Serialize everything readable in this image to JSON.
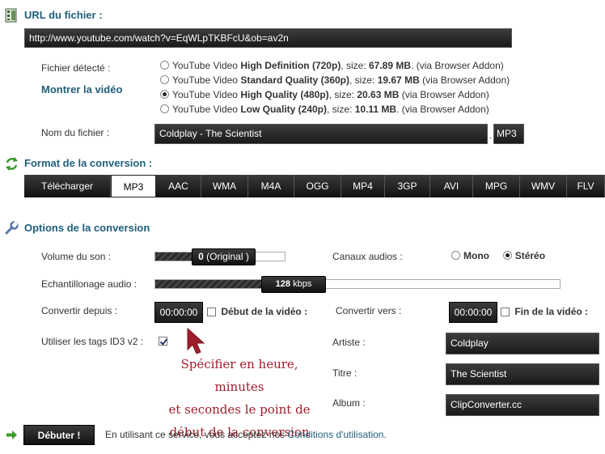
{
  "url_section": {
    "title": "URL du fichier :",
    "url_value": "http://www.youtube.com/watch?v=EqWLpTKBFcU&ob=av2n"
  },
  "detection": {
    "label": "Fichier détecté :",
    "show_video": "Montrer la vidéo",
    "options": [
      {
        "prefix": "YouTube Video ",
        "quality": "High Definition (720p)",
        "size_label": ", size: ",
        "size": "67.89 MB",
        "suffix": ". (via Browser Addon)",
        "selected": false
      },
      {
        "prefix": "YouTube Video ",
        "quality": "Standard Quality (360p)",
        "size_label": ", size: ",
        "size": "19.67 MB",
        "suffix": " (via Browser Addon)",
        "selected": false
      },
      {
        "prefix": "YouTube Video ",
        "quality": "High Quality (480p)",
        "size_label": ", size: ",
        "size": "20.63 MB",
        "suffix": " (via Browser Addon)",
        "selected": true
      },
      {
        "prefix": "YouTube Video ",
        "quality": "Low Quality (240p)",
        "size_label": ", size: ",
        "size": "10.11 MB",
        "suffix": ". (via Browser Addon)",
        "selected": false
      }
    ]
  },
  "filename": {
    "label": "Nom du fichier :",
    "value": "Coldplay - The Scientist",
    "dot": ".",
    "extension": "MP3"
  },
  "format": {
    "title": "Format de la conversion :",
    "tabs": [
      "Télécharger",
      "MP3",
      "AAC",
      "WMA",
      "M4A",
      "OGG",
      "MP4",
      "3GP",
      "AVI",
      "MPG",
      "WMV",
      "FLV"
    ],
    "active_index": 1
  },
  "options": {
    "title": "Options de la conversion",
    "volume_label": "Volume du son :",
    "volume_value": "0",
    "volume_note": " (Original )",
    "channels_label": "Canaux audios :",
    "mono": "Mono",
    "stereo": "Stéréo",
    "channel_selected": "stereo",
    "sample_label": "Echantillonage audio :",
    "sample_value": "128",
    "sample_unit": " kbps",
    "convert_from_label": "Convertir depuis :",
    "convert_from_value": "00:00:00",
    "start_video": "Début de la vidéo :",
    "convert_to_label": "Convertir vers :",
    "convert_to_value": "00:00:00",
    "end_video": "Fin de la vidéo :",
    "id3_label": "Utiliser les tags ID3 v2 :",
    "id3_checked": true,
    "artist_label": "Artiste :",
    "artist_value": "Coldplay",
    "title_label": "Titre :",
    "title_value": "The Scientist",
    "album_label": "Album :",
    "album_value": "ClipConverter.cc"
  },
  "tooltip": {
    "line1": "Spécifier en heure, minutes",
    "line2": "et secondes le point de",
    "line3": "début de la conversion"
  },
  "footer": {
    "start_button": "Débuter !",
    "terms_text": "En utilisant ce service, vous acceptez nos ",
    "terms_link": "Conditions d'utilisation",
    "terms_end": "."
  },
  "colors": {
    "accent": "#1f5f7a",
    "tooltip": "#a01d2b",
    "arrow": "#a01d2b",
    "green_arrow": "#3a9a2a"
  }
}
